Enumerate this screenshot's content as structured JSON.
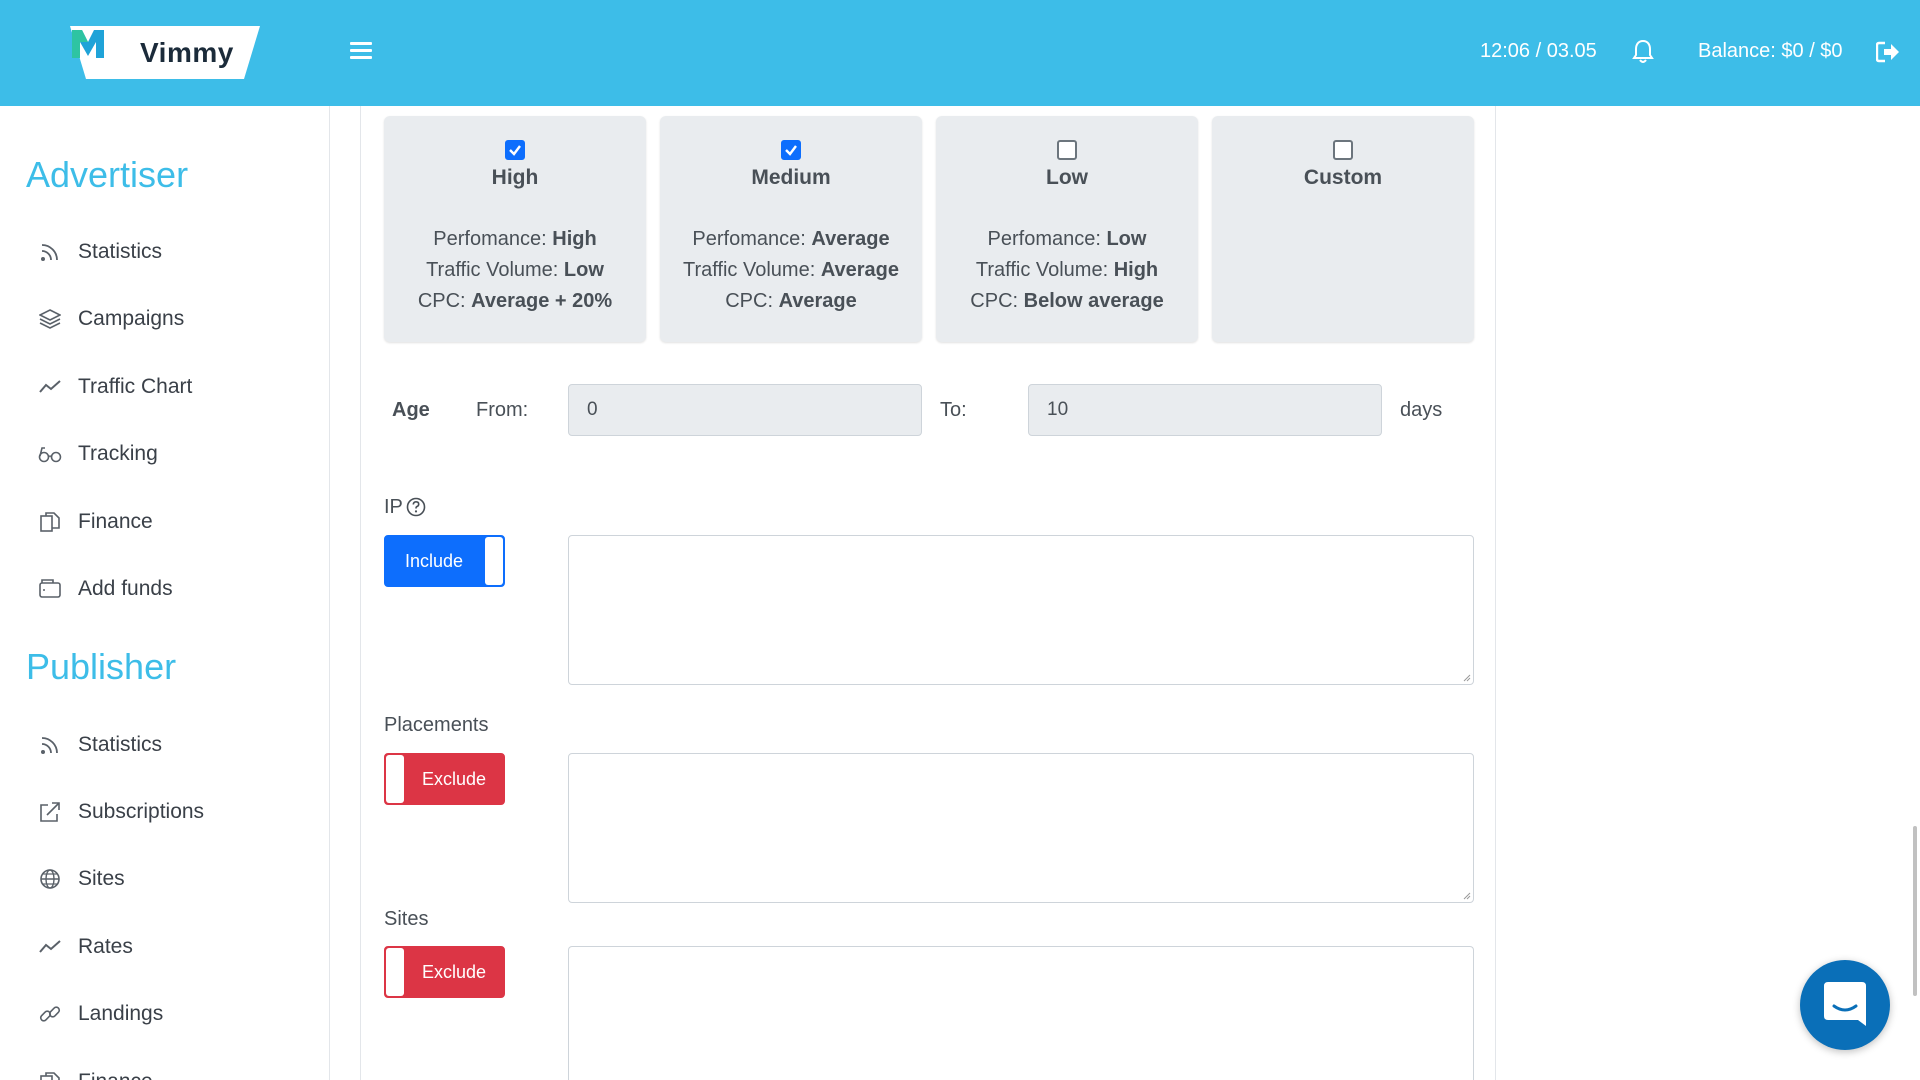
{
  "header": {
    "brand": "Vimmy",
    "datetime": "12:06 / 03.05",
    "balance": "Balance: $0 / $0",
    "accent_color": "#3dbde8"
  },
  "sidebar": {
    "advertiser": {
      "heading": "Advertiser",
      "items": [
        {
          "label": "Statistics",
          "icon": "rss-icon"
        },
        {
          "label": "Campaigns",
          "icon": "layers-icon"
        },
        {
          "label": "Traffic Chart",
          "icon": "trend-icon"
        },
        {
          "label": "Tracking",
          "icon": "glasses-icon"
        },
        {
          "label": "Finance",
          "icon": "documents-icon"
        },
        {
          "label": "Add funds",
          "icon": "wallet-icon"
        }
      ]
    },
    "publisher": {
      "heading": "Publisher",
      "items": [
        {
          "label": "Statistics",
          "icon": "rss-icon"
        },
        {
          "label": "Subscriptions",
          "icon": "share-icon"
        },
        {
          "label": "Sites",
          "icon": "globe-icon"
        },
        {
          "label": "Rates",
          "icon": "trend-icon"
        },
        {
          "label": "Landings",
          "icon": "link-icon"
        },
        {
          "label": "Finance",
          "icon": "documents-icon"
        }
      ]
    }
  },
  "presets": [
    {
      "title": "High",
      "checked": true,
      "perf_label": "Perfomance: ",
      "perf": "High",
      "vol_label": "Traffic Volume: ",
      "vol": "Low",
      "cpc_label": "CPC: ",
      "cpc": "Average + 20%"
    },
    {
      "title": "Medium",
      "checked": true,
      "perf_label": "Perfomance: ",
      "perf": "Average",
      "vol_label": "Traffic Volume: ",
      "vol": "Average",
      "cpc_label": "CPC: ",
      "cpc": "Average"
    },
    {
      "title": "Low",
      "checked": false,
      "perf_label": "Perfomance: ",
      "perf": "Low",
      "vol_label": "Traffic Volume: ",
      "vol": "High",
      "cpc_label": "CPC: ",
      "cpc": "Below average"
    },
    {
      "title": "Custom",
      "checked": false
    }
  ],
  "age": {
    "label": "Age",
    "from_label": "From:",
    "from_value": "0",
    "to_label": "To:",
    "to_value": "10",
    "unit": "days"
  },
  "ip": {
    "label": "IP",
    "toggle": "Include",
    "value": ""
  },
  "placements": {
    "label": "Placements",
    "toggle": "Exclude",
    "value": ""
  },
  "sites": {
    "label": "Sites",
    "toggle": "Exclude",
    "value": ""
  },
  "colors": {
    "include": "#0d6efd",
    "exclude": "#dc3545"
  }
}
